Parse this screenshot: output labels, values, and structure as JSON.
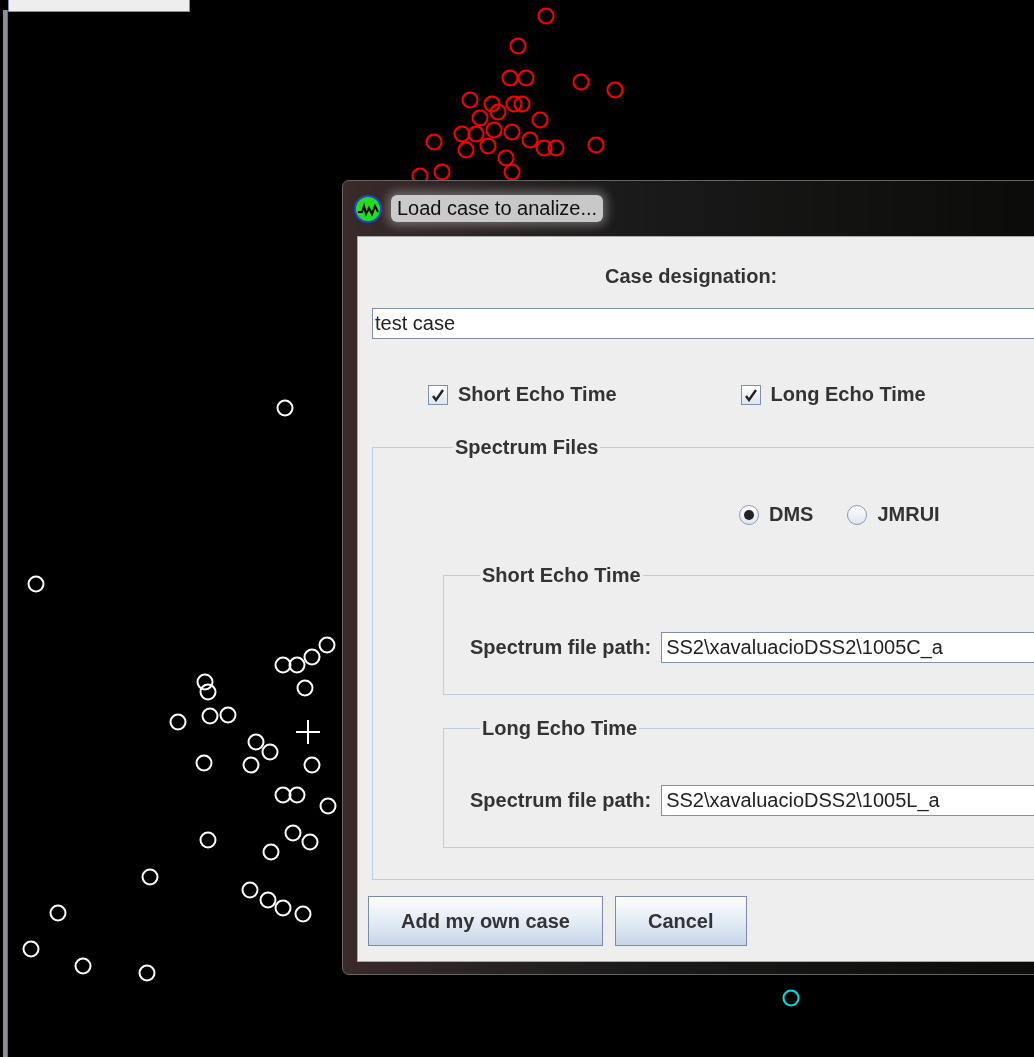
{
  "dialog": {
    "title": "Load case to analize...",
    "case_designation": {
      "label": "Case designation:",
      "value": "test case"
    },
    "echo_options": [
      {
        "label": "Short Echo Time",
        "checked": true
      },
      {
        "label": "Long Echo Time",
        "checked": true
      }
    ],
    "spectrum_files": {
      "title": "Spectrum Files",
      "formats": [
        {
          "label": "DMS",
          "selected": true
        },
        {
          "label": "JMRUI",
          "selected": false
        }
      ],
      "groups": [
        {
          "title": "Short Echo Time",
          "label": "Spectrum file path:",
          "value": "SS2\\xavaluacioDSS2\\1005C_a"
        },
        {
          "title": "Long Echo Time",
          "label": "Spectrum file path:",
          "value": "SS2\\xavaluacioDSS2\\1005L_a"
        }
      ]
    },
    "buttons": [
      "Add my own case",
      "Cancel"
    ]
  }
}
